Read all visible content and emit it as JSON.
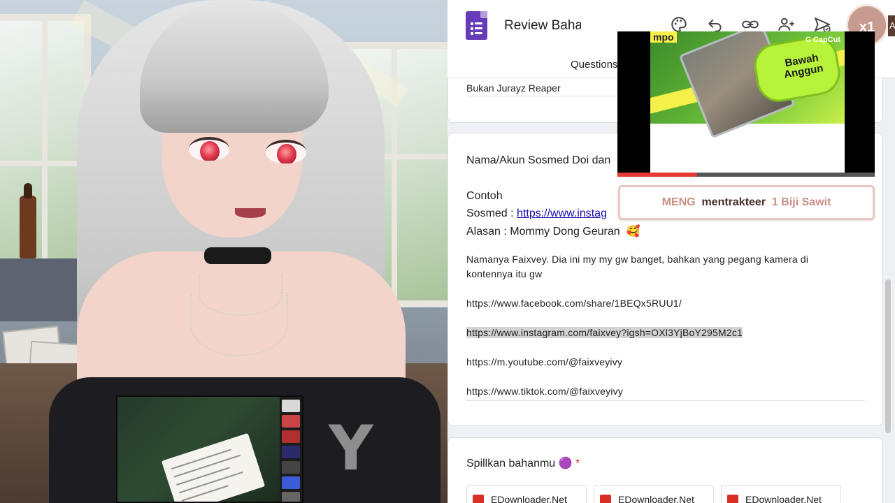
{
  "form": {
    "doc_title": "Review Bahan",
    "tab_questions": "Questions",
    "avatar_label": "x1",
    "avatar_edge": "A",
    "prev_answer": "Bukan Jurayz Reaper",
    "question": {
      "title_line": "Nama/Akun Sosmed Doi dan",
      "example_label": "Contoh",
      "sosmed_prefix": "Sosmed : ",
      "sosmed_link": "https://www.instag",
      "alasan_line": "Alasan : Mommy Dong Geuran",
      "alasan_emoji": "🥰"
    },
    "answer": {
      "line1": "Namanya Faixvey. Dia ini my my gw banget, bahkan yang pegang kamera di",
      "line2": "kontennya itu gw",
      "facebook": "https://www.facebook.com/share/1BEQx5RUU1/",
      "instagram": "https://www.instagram.com/faixvey?igsh=OXl3YjBoY295M2c1",
      "youtube": "https://m.youtube.com/@faixveyivy",
      "tiktok": "https://www.tiktok.com/@faixveyivy"
    },
    "spill_question": {
      "title": "Spillkan bahanmu",
      "emoji": "🟣",
      "required_mark": "*"
    },
    "attachments": [
      "EDownloader.Net",
      "EDownloader.Net",
      "EDownloader.Net"
    ]
  },
  "overlay": {
    "video": {
      "bubble_text": "Bawah Anggun",
      "corner_text": "C CapCut",
      "top_left_text": "mpo",
      "progress": 0.31
    },
    "donation": {
      "name": "MENG",
      "action": "mentrakteer",
      "item": "1 Biji Sawit"
    }
  },
  "colors": {
    "forms_purple": "#673ab7",
    "link_blue": "#1a0dab",
    "required_red": "#d93025",
    "highlight_gray": "#d3d3d3",
    "alert_pink": "#c98f85"
  },
  "icons": [
    "palette-icon",
    "undo-icon",
    "link-icon",
    "add-person-icon",
    "send-icon"
  ]
}
